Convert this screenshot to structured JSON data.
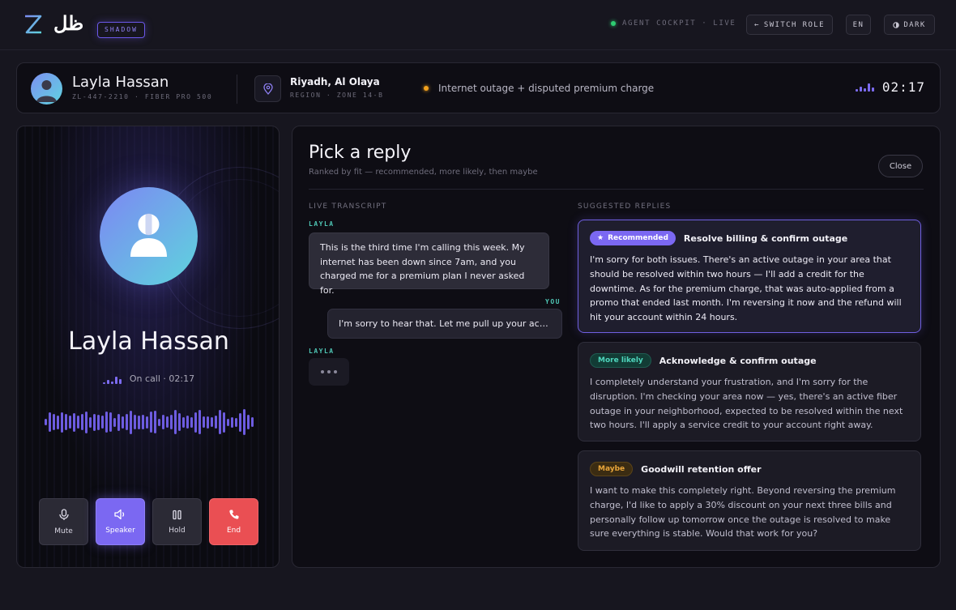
{
  "app": {
    "logo_ar": "ظل",
    "mode_badge": "SHADOW",
    "status": "AGENT COCKPIT · LIVE",
    "switch_role": "SWITCH ROLE",
    "lang": "EN",
    "theme": "DARK"
  },
  "customer": {
    "name": "Layla Hassan",
    "account": "ZL-447-2210 · FIBER PRO 500",
    "location": "Riyadh, Al Olaya",
    "location_sub": "REGION · ZONE 14-B",
    "issue": "Internet outage + disputed premium charge",
    "timer": "02:17"
  },
  "call": {
    "name": "Layla Hassan",
    "status": "On call · 02:17",
    "controls": {
      "mute": "Mute",
      "speaker": "Speaker",
      "hold": "Hold",
      "end": "End"
    }
  },
  "panel": {
    "title": "Pick a reply",
    "subtitle": "Ranked by fit — recommended, more likely, then maybe",
    "close": "Close",
    "transcript_label": "LIVE TRANSCRIPT",
    "replies_label": "SUGGESTED REPLIES"
  },
  "transcript": [
    {
      "speaker": "LAYLA",
      "text": "This is the third time I'm calling this week. My internet has been down since 7am, and you charged me for a premium plan I never asked for."
    },
    {
      "speaker": "YOU",
      "text": "I'm sorry to hear that. Let me pull up your account..."
    },
    {
      "speaker": "LAYLA",
      "text": ""
    }
  ],
  "replies": [
    {
      "badge": "Recommended",
      "title": "Resolve billing & confirm outage",
      "body": "I'm sorry for both issues. There's an active outage in your area that should be resolved within two hours — I'll add a credit for the downtime. As for the premium charge, that was auto-applied from a promo that ended last month. I'm reversing it now and the refund will hit your account within 24 hours."
    },
    {
      "badge": "More likely",
      "title": "Acknowledge & confirm outage",
      "body": "I completely understand your frustration, and I'm sorry for the disruption. I'm checking your area now — yes, there's an active fiber outage in your neighborhood, expected to be resolved within the next two hours. I'll apply a service credit to your account right away."
    },
    {
      "badge": "Maybe",
      "title": "Goodwill retention offer",
      "body": "I want to make this completely right. Beyond reversing the premium charge, I'd like to apply a 30% discount on your next three bills and personally follow up tomorrow once the outage is resolved to make sure everything is stable. Would that work for you?"
    }
  ],
  "colors": {
    "accent": "#7b68f2",
    "live": "#2ecc71",
    "issue": "#f2a11d",
    "end": "#ea4f53",
    "speaker": "#4fc6b5"
  }
}
